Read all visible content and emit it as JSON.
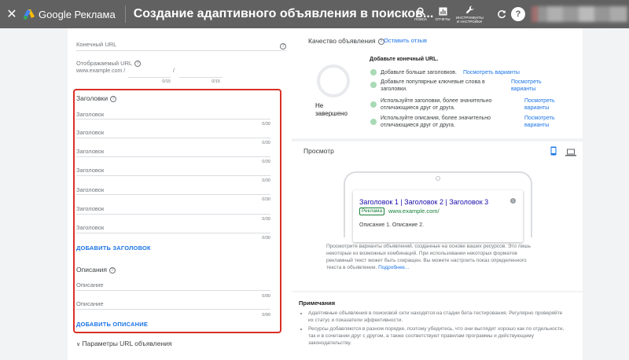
{
  "header": {
    "close_icon": "close-icon",
    "logo_text": "Google Реклама",
    "title": "Создание адаптивного объявления в поисков...",
    "tools": [
      {
        "icon": "search-icon",
        "label": "ПОИСК"
      },
      {
        "icon": "reports-icon",
        "label": "ОТЧЕТЫ"
      },
      {
        "icon": "wrench-icon",
        "label": "ИНСТРУМЕНТЫ И НАСТРОЙКИ"
      }
    ]
  },
  "form": {
    "final_url_label": "Конечный URL",
    "display_url_label": "Отображаемый URL",
    "display_url_prefix": "www.example.com /",
    "path_sep": "/",
    "path1_counter": "0/15",
    "path2_counter": "0/15",
    "headlines_title": "Заголовки",
    "headlines": [
      {
        "placeholder": "Заголовок",
        "counter": "0/30"
      },
      {
        "placeholder": "Заголовок",
        "counter": "0/30"
      },
      {
        "placeholder": "Заголовок",
        "counter": "0/30"
      },
      {
        "placeholder": "Заголовок",
        "counter": "0/30"
      },
      {
        "placeholder": "Заголовок",
        "counter": "0/30"
      },
      {
        "placeholder": "Заголовок",
        "counter": "0/30"
      },
      {
        "placeholder": "Заголовок",
        "counter": "0/30"
      }
    ],
    "add_headline": "ДОБАВИТЬ ЗАГОЛОВОК",
    "descriptions_title": "Описания",
    "descriptions": [
      {
        "placeholder": "Описание",
        "counter": "0/90"
      },
      {
        "placeholder": "Описание",
        "counter": "0/90"
      }
    ],
    "add_description": "ДОБАВИТЬ ОПИСАНИЕ",
    "url_params": "Параметры URL объявления"
  },
  "quality": {
    "title": "Качество объявления",
    "feedback_link": "Оставить отзыв",
    "status": "Не завершено",
    "headline": "Добавьте конечный URL.",
    "items": [
      {
        "text": "Добавьте больше заголовков.",
        "action": "Посмотреть варианты"
      },
      {
        "text": "Добавьте популярные ключевые слова в заголовки.",
        "action": "Посмотреть варианты"
      },
      {
        "text": "Используйте заголовки, более значительно отличающиеся друг от друга.",
        "action": "Посмотреть варианты"
      },
      {
        "text": "Используйте описания, более значительно отличающиеся друг от друга.",
        "action": "Посмотреть варианты"
      }
    ]
  },
  "preview": {
    "title": "Просмотр",
    "ad_title": "Заголовок 1 | Заголовок 2 | Заголовок 3",
    "ad_badge": "Реклама",
    "ad_url": "www.example.com/",
    "ad_description": "Описание 1. Описание 2.",
    "note": "Просмотрите варианты объявлений, созданные на основе ваших ресурсов. Это лишь некоторые из возможных комбинаций. При использовании некоторых форматов рекламный текст может быть сокращен. Вы можете настроить показ определенного текста в объявлении.",
    "note_link": "Подробнее..."
  },
  "notes": {
    "title": "Примечания",
    "items": [
      "Адаптивные объявления в поисковой сети находятся на стадии бета-тестирования. Регулярно проверяйте их статус и показатели эффективности.",
      "Ресурсы добавляются в разном порядке, поэтому убедитесь, что они выглядят хорошо как по отдельности, так и в сочетании друг с другом, а также соответствуют правилам программы и действующему законодательству."
    ]
  },
  "colors": {
    "accent": "#1a73e8",
    "header_bg": "#616161",
    "highlight_border": "#d93025"
  }
}
